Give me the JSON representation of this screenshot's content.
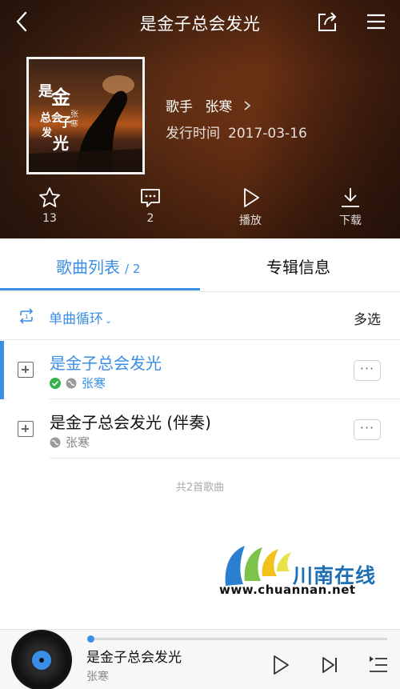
{
  "header": {
    "title": "是金子总会发光",
    "back_icon": "chevron-left-icon",
    "share_icon": "share-icon",
    "menu_icon": "hamburger-menu-icon"
  },
  "album": {
    "cover_text": "是金子总会发光",
    "cover_artist": "张寒",
    "artist_label": "歌手",
    "artist_name": "张寒",
    "release_label": "发行时间",
    "release_date": "2017-03-16"
  },
  "actions": {
    "favorite_count": "13",
    "comment_count": "2",
    "play_label": "播放",
    "download_label": "下载"
  },
  "tabs": {
    "songs_label": "歌曲列表",
    "songs_count": "/ 2",
    "album_info_label": "专辑信息",
    "active": "songs"
  },
  "toolbar": {
    "mode_label": "单曲循环",
    "multi_select_label": "多选"
  },
  "songs": [
    {
      "title": "是金子总会发光",
      "artist": "张寒",
      "downloaded": true,
      "playing": true,
      "more": "···"
    },
    {
      "title": "是金子总会发光 (伴奏)",
      "artist": "张寒",
      "downloaded": false,
      "playing": false,
      "more": "···"
    }
  ],
  "list_footer": "共2首歌曲",
  "watermark": {
    "name": "川南在线",
    "url": "www.chuannan.net"
  },
  "player": {
    "title": "是金子总会发光",
    "artist": "张寒",
    "progress": 0.0
  },
  "colors": {
    "accent": "#3a8ee6",
    "downloaded": "#36b24a"
  }
}
